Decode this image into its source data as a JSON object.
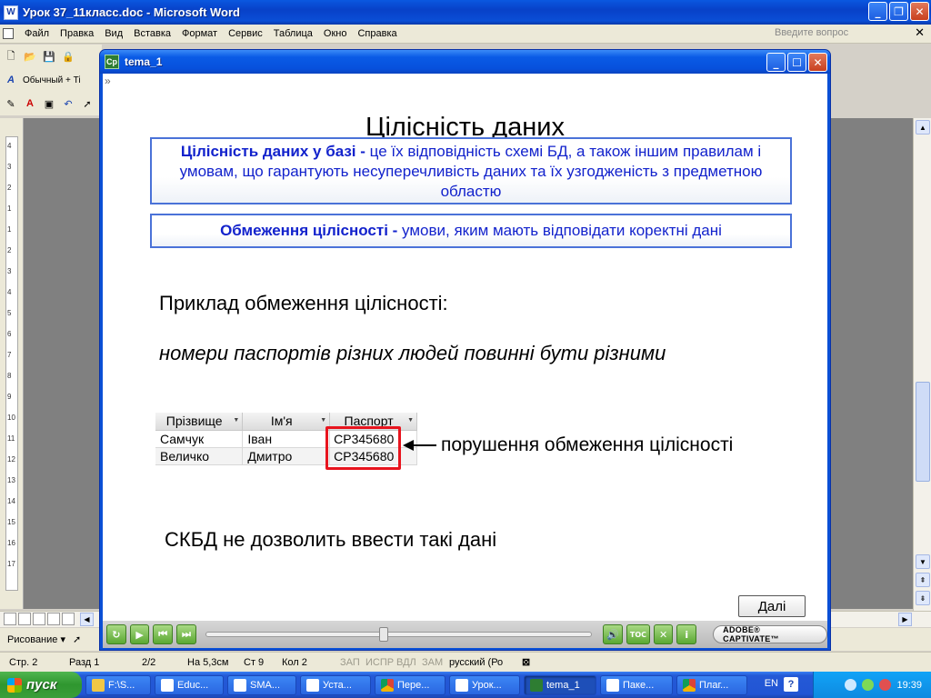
{
  "word": {
    "title": "Урок 37_11класс.doc - Microsoft Word",
    "menu": [
      "Файл",
      "Правка",
      "Вид",
      "Вставка",
      "Формат",
      "Сервис",
      "Таблица",
      "Окно",
      "Справка"
    ],
    "ask_placeholder": "Введите вопрос",
    "style_box": "Обычный + Ti",
    "draw_label": "Рисование ▾",
    "ruler_numbers": [
      "4",
      "3",
      "2",
      "1",
      "1",
      "2",
      "3",
      "4",
      "5",
      "6",
      "7",
      "8",
      "9",
      "10",
      "11",
      "12",
      "13",
      "14",
      "15",
      "16",
      "17"
    ],
    "status": {
      "page": "Стр. 2",
      "section": "Разд 1",
      "pages": "2/2",
      "at": "На 5,3см",
      "line": "Ст 9",
      "col": "Кол 2",
      "rec": "ЗАП",
      "trk": "ИСПР",
      "ext": "ВДЛ",
      "ovr": "ЗАМ",
      "lang": "русский (Ро"
    }
  },
  "captivate": {
    "window_title": "tema_1",
    "slide": {
      "title": "Цілісність даних",
      "def1_bold": "Цілісність даних у базі -",
      "def1_text": " це їх відповідність схемі БД, а також іншим правилам і умовам, що гарантують несуперечливість даних та їх узгодженість з предметною областю",
      "def2_bold": "Обмеження цілісності -",
      "def2_text": " умови, яким мають відповідати коректні дані",
      "example_head": "Приклад обмеження цілісності:",
      "example_body": "номери паспортів різних людей повинні бути різними",
      "table": {
        "headers": [
          "Прізвище",
          "Ім'я",
          "Паспорт"
        ],
        "rows": [
          [
            "Самчук",
            "Іван",
            "СР345680"
          ],
          [
            "Величко",
            "Дмитро",
            "СР345680"
          ]
        ]
      },
      "violation_label": "порушення обмеження цілісності",
      "dbms_note": "СКБД не дозволить ввести такі дані",
      "next_button": "Далі"
    },
    "player": {
      "adobe_badge": "ADOBE® CAPTIVATE™",
      "toc_label": "TOC"
    }
  },
  "taskbar": {
    "start": "пуск",
    "tasks": [
      "F:\\S...",
      "Educ...",
      "SMA...",
      "Уста...",
      "Пере...",
      "Урок...",
      "tema_1",
      "Паке...",
      "Плаг..."
    ],
    "lang": "EN",
    "clock": "19:39"
  }
}
